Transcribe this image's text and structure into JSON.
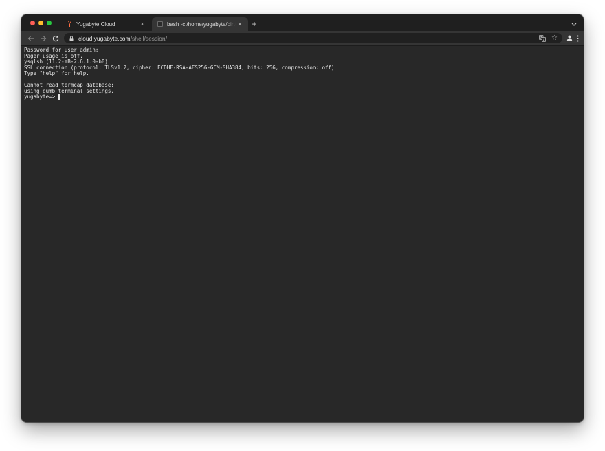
{
  "tabs": [
    {
      "title": "Yugabyte Cloud",
      "active": false,
      "close_label": "×"
    },
    {
      "title": "bash -c /home/yugabyte/bin/ysqlsh",
      "active": true,
      "close_label": "×"
    }
  ],
  "new_tab_label": "+",
  "toolbar": {
    "url_host": "cloud.yugabyte.com",
    "url_path": "/shell/session/",
    "star_label": "☆"
  },
  "terminal": {
    "lines": [
      "Password for user admin:",
      "Pager usage is off.",
      "ysqlsh (11.2-YB-2.6.1.0-b0)",
      "SSL connection (protocol: TLSv1.2, cipher: ECDHE-RSA-AES256-GCM-SHA384, bits: 256, compression: off)",
      "Type \"help\" for help.",
      "",
      "Cannot read termcap database;",
      "using dumb terminal settings."
    ],
    "prompt": "yugabyte=>"
  },
  "colors": {
    "window_bg": "#282828",
    "tabstrip_bg": "#1f1f1f",
    "toolbar_bg": "#353535",
    "omnibox_bg": "#202020",
    "terminal_text": "#e6e6e6",
    "traffic_close": "#fe5f57",
    "traffic_minimize": "#febc2e",
    "traffic_maximize": "#28c840",
    "yugabyte_brand": "#ff6e42"
  },
  "icons": {
    "tab1_favicon": "yugabyte-logo-icon",
    "tab2_favicon": "terminal-icon",
    "tab_search": "chevron-down-icon",
    "back": "arrow-left-icon",
    "forward": "arrow-right-icon",
    "reload": "reload-icon",
    "lock": "lock-icon",
    "translate": "translate-icon",
    "bookmark": "star-icon",
    "profile": "profile-icon",
    "menu": "kebab-menu-icon"
  }
}
